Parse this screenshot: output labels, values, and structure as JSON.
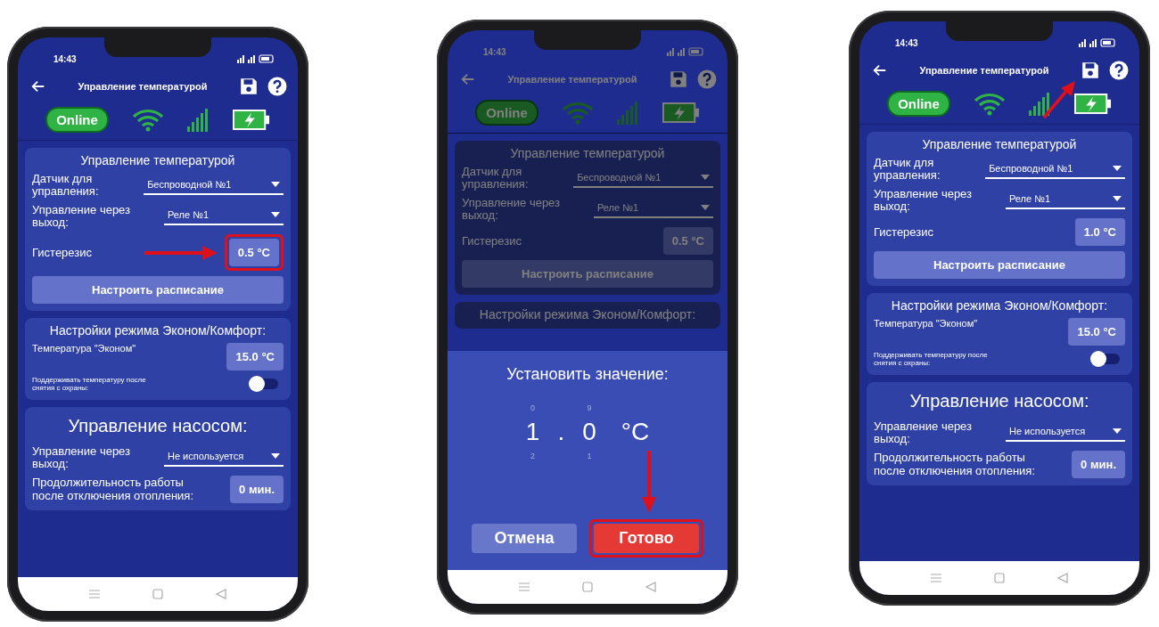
{
  "phones": [
    {
      "status_time": "14:43",
      "title": "Управление температурой",
      "dimmed": false,
      "online_label": "Online",
      "online": true,
      "temperature": {
        "title": "Управление температурой",
        "sensor_label": "Датчик для управления:",
        "sensor_value": "Беспроводной №1",
        "output_label": "Управление через выход:",
        "output_value": "Реле №1",
        "hysteresis_label": "Гистерезис",
        "hysteresis_value": "0.5 °C",
        "hysteresis_highlighted": true,
        "schedule_button": "Настроить расписание"
      },
      "econ": {
        "title": "Настройки режима Эконом/Комфорт:",
        "temp_label": "Температура \"Эконом\"",
        "temp_value": "15.0 °C",
        "keep_label": "Поддерживать температуру после снятия с охраны:",
        "keep_on": false
      },
      "pump": {
        "title": "Управление насосом:",
        "output_label": "Управление через выход:",
        "output_value": "Не используется",
        "duration_label": "Продолжительность работы после отключения отопления:",
        "duration_value": "0 мин."
      }
    },
    {
      "status_time": "14:43",
      "title": "Управление температурой",
      "dimmed": true,
      "online_label": "Online",
      "online": true,
      "temperature": {
        "title": "Управление температурой",
        "sensor_label": "Датчик для управления:",
        "sensor_value": "Беспроводной №1",
        "output_label": "Управление через выход:",
        "output_value": "Реле №1",
        "hysteresis_label": "Гистерезис",
        "hysteresis_value": "0.5 °C",
        "schedule_button": "Настроить расписание"
      },
      "econ": {
        "title": "Настройки режима Эконом/Комфорт:"
      },
      "dialog": {
        "title": "Установить значение:",
        "wheels": [
          {
            "above": "0",
            "value": "1",
            "below": "2"
          },
          {
            "above": "9",
            "value": "0",
            "below": "1"
          }
        ],
        "separator": ".",
        "unit": "°C",
        "cancel_button": "Отмена",
        "done_button": "Готово",
        "done_highlighted": true
      }
    },
    {
      "status_time": "14:43",
      "title": "Управление температурой",
      "save_highlighted": true,
      "dimmed": false,
      "online_label": "Online",
      "online": true,
      "temperature": {
        "title": "Управление температурой",
        "sensor_label": "Датчик для управления:",
        "sensor_value": "Беспроводной №1",
        "output_label": "Управление через выход:",
        "output_value": "Реле №1",
        "hysteresis_label": "Гистерезис",
        "hysteresis_value": "1.0 °C",
        "schedule_button": "Настроить расписание"
      },
      "econ": {
        "title": "Настройки режима Эконом/Комфорт:",
        "temp_label": "Температура \"Эконом\"",
        "temp_value": "15.0 °C",
        "keep_label": "Поддерживать температуру после снятия с охраны:",
        "keep_on": false
      },
      "pump": {
        "title": "Управление насосом:",
        "output_label": "Управление через выход:",
        "output_value": "Не используется",
        "duration_label": "Продолжительность работы после отключения отопления:",
        "duration_value": "0 мин."
      }
    }
  ]
}
